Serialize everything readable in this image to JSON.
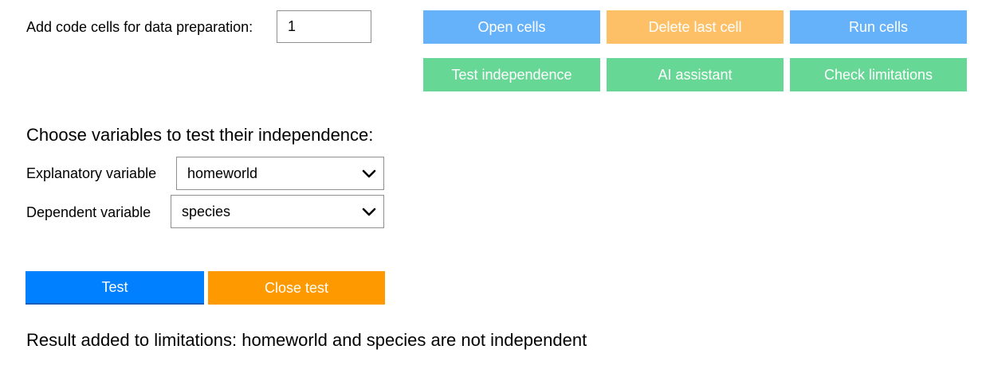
{
  "code_cells": {
    "label": "Add code cells for data preparation:",
    "value": "1"
  },
  "toolbar": {
    "open_cells": "Open cells",
    "delete_last_cell": "Delete last cell",
    "run_cells": "Run cells",
    "test_independence": "Test independence",
    "ai_assistant": "AI assistant",
    "check_limitations": "Check limitations"
  },
  "independence_test": {
    "heading": "Choose variables to test their independence:",
    "explanatory_label": "Explanatory variable",
    "explanatory_value": "homeworld",
    "dependent_label": "Dependent variable",
    "dependent_value": "species",
    "test_button": "Test",
    "close_button": "Close test",
    "result": "Result added to limitations: homeworld and species are not independent"
  },
  "icons": {
    "dropdown": "chevron-down-icon"
  },
  "colors": {
    "light_blue": "#66b2fa",
    "light_orange": "#fec066",
    "light_green": "#66d795",
    "blue": "#0080fe",
    "orange": "#fe9900"
  }
}
